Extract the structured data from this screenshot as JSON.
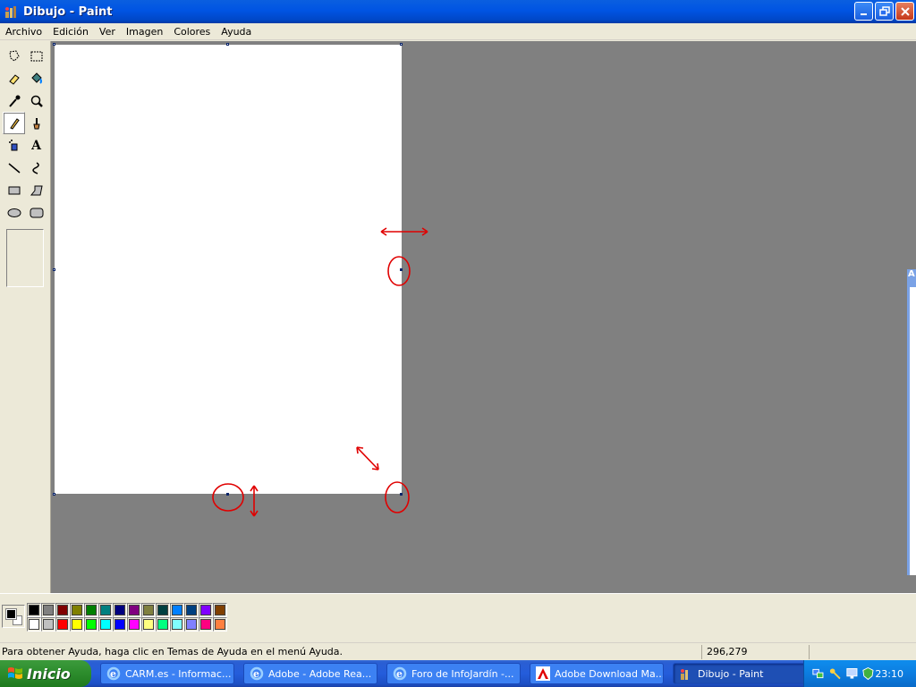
{
  "window": {
    "title": "Dibujo - Paint"
  },
  "menubar": {
    "items": [
      "Archivo",
      "Edición",
      "Ver",
      "Imagen",
      "Colores",
      "Ayuda"
    ]
  },
  "tools": [
    {
      "name": "free-form-select"
    },
    {
      "name": "rect-select"
    },
    {
      "name": "eraser"
    },
    {
      "name": "fill-with-color"
    },
    {
      "name": "pick-color"
    },
    {
      "name": "magnifier"
    },
    {
      "name": "pencil",
      "active": true
    },
    {
      "name": "brush"
    },
    {
      "name": "airbrush"
    },
    {
      "name": "text",
      "glyph": "A"
    },
    {
      "name": "line"
    },
    {
      "name": "curve"
    },
    {
      "name": "rectangle"
    },
    {
      "name": "polygon"
    },
    {
      "name": "ellipse"
    },
    {
      "name": "rounded-rectangle"
    }
  ],
  "side_window": {
    "tab_label": "A"
  },
  "palette": {
    "foreground": "#000000",
    "background": "#ffffff",
    "colors": [
      "#000000",
      "#808080",
      "#800000",
      "#808000",
      "#008000",
      "#008080",
      "#000080",
      "#800080",
      "#808040",
      "#004040",
      "#0080ff",
      "#004080",
      "#8000ff",
      "#804000",
      "#ffffff",
      "#c0c0c0",
      "#ff0000",
      "#ffff00",
      "#00ff00",
      "#00ffff",
      "#0000ff",
      "#ff00ff",
      "#ffff80",
      "#00ff80",
      "#80ffff",
      "#8080ff",
      "#ff0080",
      "#ff8040"
    ]
  },
  "statusbar": {
    "help_text": "Para obtener Ayuda, haga clic en Temas de Ayuda en el menú Ayuda.",
    "coords": "296,279"
  },
  "taskbar": {
    "start_label": "Inicio",
    "tasks": [
      {
        "label": "CARM.es - Informac...",
        "icon": "ie-icon"
      },
      {
        "label": "Adobe - Adobe Rea...",
        "icon": "ie-icon"
      },
      {
        "label": "Foro de InfoJardín -...",
        "icon": "ie-icon"
      },
      {
        "label": "Adobe Download Ma...",
        "icon": "adobe-icon"
      },
      {
        "label": "Dibujo - Paint",
        "icon": "paint-icon",
        "active": true
      }
    ],
    "clock": "23:10"
  },
  "colors": {
    "annotation": "#e00000",
    "workspace": "#808080",
    "titlebar": "#0054e3"
  }
}
